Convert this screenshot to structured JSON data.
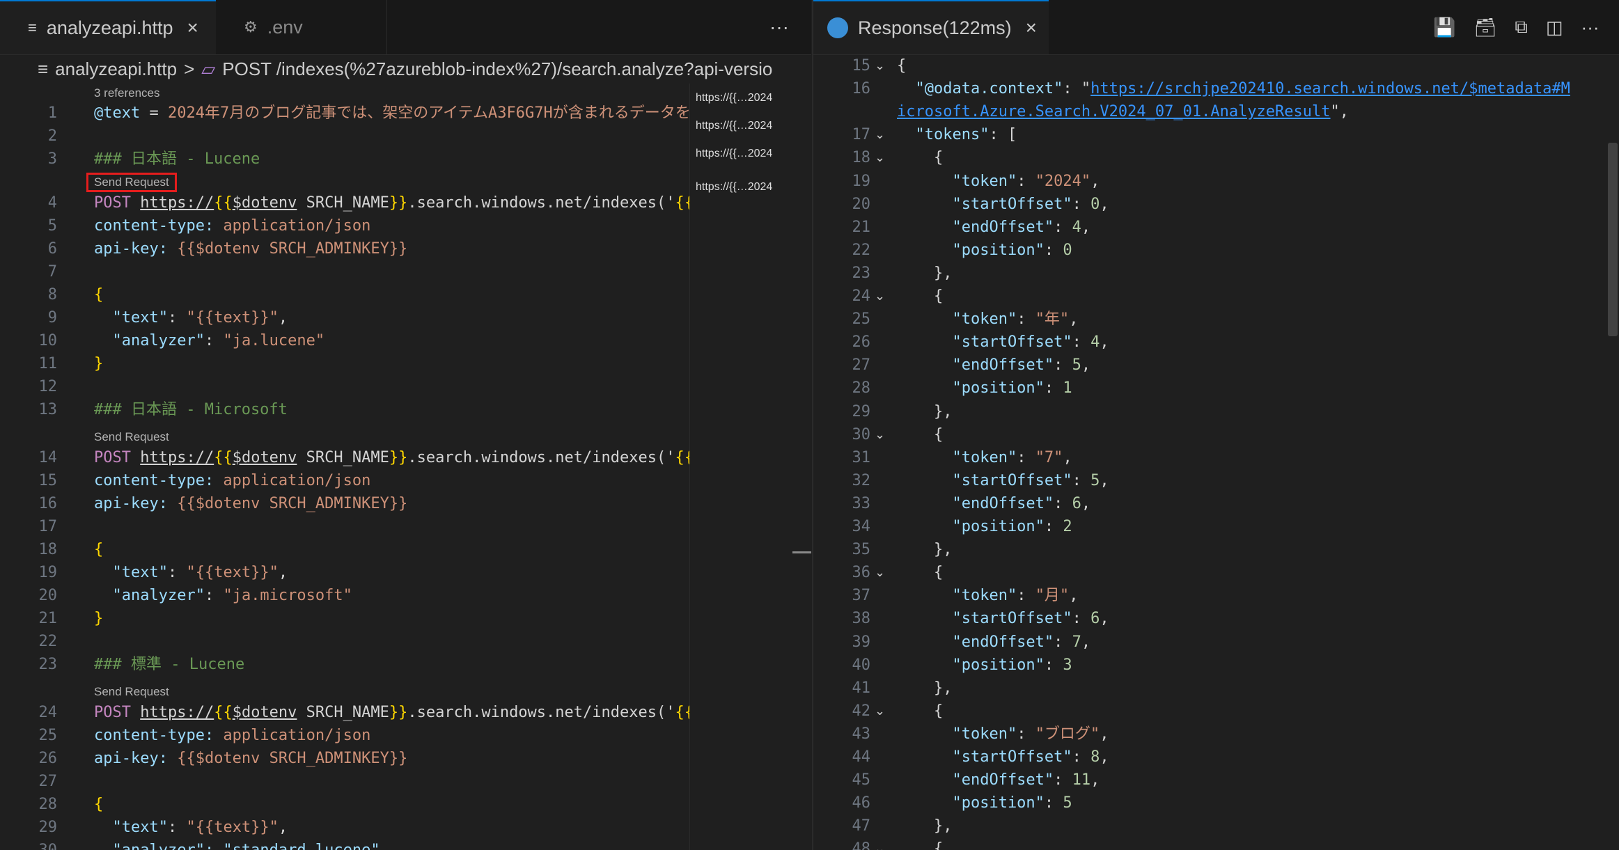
{
  "left": {
    "tabs": [
      {
        "label": "analyzeapi.http",
        "icon": "lines-icon",
        "active": true
      },
      {
        "label": ".env",
        "icon": "gear-icon",
        "active": false
      }
    ],
    "more": "···",
    "breadcrumb": {
      "file": "analyzeapi.http",
      "separator": ">",
      "symbol": "POST /indexes(%27azureblob-index%27)/search.analyze?api-versio"
    },
    "codelens": {
      "references": "3 references",
      "send_request": "Send Request"
    },
    "lines": [
      {
        "n": "1",
        "tokens": [
          [
            "@text",
            "k-meta"
          ],
          [
            " = ",
            "k-plain"
          ],
          [
            "2024年7月のブログ記事では、架空のアイテムA3F6G7Hが含まれるデータを",
            "k-val"
          ]
        ]
      },
      {
        "n": "2",
        "tokens": []
      },
      {
        "n": "3",
        "tokens": [
          [
            "### 日本語 - Lucene",
            "k-com"
          ]
        ]
      },
      {
        "n": "4",
        "tokens": [
          [
            "POST ",
            "k-method"
          ],
          [
            "https://",
            "k-url"
          ],
          [
            "{{",
            "k-brace"
          ],
          [
            "$dotenv",
            "k-url"
          ],
          [
            " SRCH_NAME",
            "k-plain"
          ],
          [
            "}}",
            "k-brace"
          ],
          [
            ".search.windows.net/indexes('",
            "k-plain"
          ],
          [
            "{{",
            "k-brace"
          ]
        ]
      },
      {
        "n": "5",
        "tokens": [
          [
            "content-type:",
            "k-meta"
          ],
          [
            " application/json",
            "k-val"
          ]
        ]
      },
      {
        "n": "6",
        "tokens": [
          [
            "api-key:",
            "k-meta"
          ],
          [
            " {{$dotenv SRCH_ADMINKEY}}",
            "k-val"
          ]
        ]
      },
      {
        "n": "7",
        "tokens": []
      },
      {
        "n": "8",
        "tokens": [
          [
            "{",
            "k-brace"
          ]
        ]
      },
      {
        "n": "9",
        "tokens": [
          [
            "  \"text\"",
            "k-key"
          ],
          [
            ": ",
            "k-plain"
          ],
          [
            "\"{{text}}\"",
            "k-str"
          ],
          [
            ",",
            "k-plain"
          ]
        ]
      },
      {
        "n": "10",
        "tokens": [
          [
            "  \"analyzer\"",
            "k-key"
          ],
          [
            ": ",
            "k-plain"
          ],
          [
            "\"ja.lucene\"",
            "k-str"
          ]
        ]
      },
      {
        "n": "11",
        "tokens": [
          [
            "}",
            "k-brace"
          ]
        ]
      },
      {
        "n": "12",
        "tokens": []
      },
      {
        "n": "13",
        "tokens": [
          [
            "### 日本語 - Microsoft",
            "k-com"
          ]
        ]
      },
      {
        "n": "14",
        "tokens": [
          [
            "POST ",
            "k-method"
          ],
          [
            "https://",
            "k-url"
          ],
          [
            "{{",
            "k-brace"
          ],
          [
            "$dotenv",
            "k-url"
          ],
          [
            " SRCH_NAME",
            "k-plain"
          ],
          [
            "}}",
            "k-brace"
          ],
          [
            ".search.windows.net/indexes('",
            "k-plain"
          ],
          [
            "{{",
            "k-brace"
          ]
        ]
      },
      {
        "n": "15",
        "tokens": [
          [
            "content-type:",
            "k-meta"
          ],
          [
            " application/json",
            "k-val"
          ]
        ]
      },
      {
        "n": "16",
        "tokens": [
          [
            "api-key:",
            "k-meta"
          ],
          [
            " {{$dotenv SRCH_ADMINKEY}}",
            "k-val"
          ]
        ]
      },
      {
        "n": "17",
        "tokens": []
      },
      {
        "n": "18",
        "tokens": [
          [
            "{",
            "k-brace"
          ]
        ]
      },
      {
        "n": "19",
        "tokens": [
          [
            "  \"text\"",
            "k-key"
          ],
          [
            ": ",
            "k-plain"
          ],
          [
            "\"{{text}}\"",
            "k-str"
          ],
          [
            ",",
            "k-plain"
          ]
        ]
      },
      {
        "n": "20",
        "tokens": [
          [
            "  \"analyzer\"",
            "k-key"
          ],
          [
            ": ",
            "k-plain"
          ],
          [
            "\"ja.microsoft\"",
            "k-str"
          ]
        ]
      },
      {
        "n": "21",
        "tokens": [
          [
            "}",
            "k-brace"
          ]
        ]
      },
      {
        "n": "22",
        "tokens": []
      },
      {
        "n": "23",
        "tokens": [
          [
            "### 標準 - Lucene",
            "k-com"
          ]
        ]
      },
      {
        "n": "24",
        "tokens": [
          [
            "POST ",
            "k-method"
          ],
          [
            "https://",
            "k-url"
          ],
          [
            "{{",
            "k-brace"
          ],
          [
            "$dotenv",
            "k-url"
          ],
          [
            " SRCH_NAME",
            "k-plain"
          ],
          [
            "}}",
            "k-brace"
          ],
          [
            ".search.windows.net/indexes('",
            "k-plain"
          ],
          [
            "{{",
            "k-brace"
          ]
        ]
      },
      {
        "n": "25",
        "tokens": [
          [
            "content-type:",
            "k-meta"
          ],
          [
            " application/json",
            "k-val"
          ]
        ]
      },
      {
        "n": "26",
        "tokens": [
          [
            "api-key:",
            "k-meta"
          ],
          [
            " {{$dotenv SRCH_ADMINKEY}}",
            "k-val"
          ]
        ]
      },
      {
        "n": "27",
        "tokens": []
      },
      {
        "n": "28",
        "tokens": [
          [
            "{",
            "k-brace"
          ]
        ]
      },
      {
        "n": "29",
        "tokens": [
          [
            "  \"text\"",
            "k-key"
          ],
          [
            ": ",
            "k-plain"
          ],
          [
            "\"{{text}}\"",
            "k-str"
          ],
          [
            ",",
            "k-plain"
          ]
        ]
      },
      {
        "n": "30",
        "tokens": [
          [
            "  \"analyzer\": \"standard.lucene\"",
            "k-key"
          ]
        ]
      }
    ],
    "minimap_items": [
      "https://{{…2024",
      "https://{{…2024",
      "https://{{…2024",
      "https://{{…2024"
    ]
  },
  "right": {
    "tab": {
      "label": "Response(122ms)",
      "icon": "globe-icon"
    },
    "actions": [
      "save-icon",
      "save-all-icon",
      "copy-icon",
      "split-editor-icon",
      "more-icon"
    ],
    "more": "···",
    "lines": [
      {
        "n": "15",
        "fold": true,
        "tokens": [
          [
            "{",
            "k-plain"
          ]
        ]
      },
      {
        "n": "16",
        "fold": false,
        "tokens": [
          [
            "  \"@odata.context\"",
            "k-key"
          ],
          [
            ": \"",
            "k-plain"
          ],
          [
            "https://srchjpe202410.search.windows.net/$metadata#M",
            "k-link"
          ]
        ]
      },
      {
        "n": "",
        "fold": false,
        "tokens": [
          [
            "icrosoft.Azure.Search.V2024_07_01.AnalyzeResult",
            "k-link"
          ],
          [
            "\",",
            "k-plain"
          ]
        ]
      },
      {
        "n": "17",
        "fold": true,
        "tokens": [
          [
            "  \"tokens\"",
            "k-key"
          ],
          [
            ": [",
            "k-plain"
          ]
        ]
      },
      {
        "n": "18",
        "fold": true,
        "tokens": [
          [
            "    {",
            "k-plain"
          ]
        ]
      },
      {
        "n": "19",
        "fold": false,
        "tokens": [
          [
            "      \"token\"",
            "k-key"
          ],
          [
            ": ",
            "k-plain"
          ],
          [
            "\"2024\"",
            "k-str"
          ],
          [
            ",",
            "k-plain"
          ]
        ]
      },
      {
        "n": "20",
        "fold": false,
        "tokens": [
          [
            "      \"startOffset\"",
            "k-key"
          ],
          [
            ": ",
            "k-plain"
          ],
          [
            "0",
            "k-num"
          ],
          [
            ",",
            "k-plain"
          ]
        ]
      },
      {
        "n": "21",
        "fold": false,
        "tokens": [
          [
            "      \"endOffset\"",
            "k-key"
          ],
          [
            ": ",
            "k-plain"
          ],
          [
            "4",
            "k-num"
          ],
          [
            ",",
            "k-plain"
          ]
        ]
      },
      {
        "n": "22",
        "fold": false,
        "tokens": [
          [
            "      \"position\"",
            "k-key"
          ],
          [
            ": ",
            "k-plain"
          ],
          [
            "0",
            "k-num"
          ]
        ]
      },
      {
        "n": "23",
        "fold": false,
        "tokens": [
          [
            "    },",
            "k-plain"
          ]
        ]
      },
      {
        "n": "24",
        "fold": true,
        "tokens": [
          [
            "    {",
            "k-plain"
          ]
        ]
      },
      {
        "n": "25",
        "fold": false,
        "tokens": [
          [
            "      \"token\"",
            "k-key"
          ],
          [
            ": ",
            "k-plain"
          ],
          [
            "\"年\"",
            "k-str"
          ],
          [
            ",",
            "k-plain"
          ]
        ]
      },
      {
        "n": "26",
        "fold": false,
        "tokens": [
          [
            "      \"startOffset\"",
            "k-key"
          ],
          [
            ": ",
            "k-plain"
          ],
          [
            "4",
            "k-num"
          ],
          [
            ",",
            "k-plain"
          ]
        ]
      },
      {
        "n": "27",
        "fold": false,
        "tokens": [
          [
            "      \"endOffset\"",
            "k-key"
          ],
          [
            ": ",
            "k-plain"
          ],
          [
            "5",
            "k-num"
          ],
          [
            ",",
            "k-plain"
          ]
        ]
      },
      {
        "n": "28",
        "fold": false,
        "tokens": [
          [
            "      \"position\"",
            "k-key"
          ],
          [
            ": ",
            "k-plain"
          ],
          [
            "1",
            "k-num"
          ]
        ]
      },
      {
        "n": "29",
        "fold": false,
        "tokens": [
          [
            "    },",
            "k-plain"
          ]
        ]
      },
      {
        "n": "30",
        "fold": true,
        "tokens": [
          [
            "    {",
            "k-plain"
          ]
        ]
      },
      {
        "n": "31",
        "fold": false,
        "tokens": [
          [
            "      \"token\"",
            "k-key"
          ],
          [
            ": ",
            "k-plain"
          ],
          [
            "\"7\"",
            "k-str"
          ],
          [
            ",",
            "k-plain"
          ]
        ]
      },
      {
        "n": "32",
        "fold": false,
        "tokens": [
          [
            "      \"startOffset\"",
            "k-key"
          ],
          [
            ": ",
            "k-plain"
          ],
          [
            "5",
            "k-num"
          ],
          [
            ",",
            "k-plain"
          ]
        ]
      },
      {
        "n": "33",
        "fold": false,
        "tokens": [
          [
            "      \"endOffset\"",
            "k-key"
          ],
          [
            ": ",
            "k-plain"
          ],
          [
            "6",
            "k-num"
          ],
          [
            ",",
            "k-plain"
          ]
        ]
      },
      {
        "n": "34",
        "fold": false,
        "tokens": [
          [
            "      \"position\"",
            "k-key"
          ],
          [
            ": ",
            "k-plain"
          ],
          [
            "2",
            "k-num"
          ]
        ]
      },
      {
        "n": "35",
        "fold": false,
        "tokens": [
          [
            "    },",
            "k-plain"
          ]
        ]
      },
      {
        "n": "36",
        "fold": true,
        "tokens": [
          [
            "    {",
            "k-plain"
          ]
        ]
      },
      {
        "n": "37",
        "fold": false,
        "tokens": [
          [
            "      \"token\"",
            "k-key"
          ],
          [
            ": ",
            "k-plain"
          ],
          [
            "\"月\"",
            "k-str"
          ],
          [
            ",",
            "k-plain"
          ]
        ]
      },
      {
        "n": "38",
        "fold": false,
        "tokens": [
          [
            "      \"startOffset\"",
            "k-key"
          ],
          [
            ": ",
            "k-plain"
          ],
          [
            "6",
            "k-num"
          ],
          [
            ",",
            "k-plain"
          ]
        ]
      },
      {
        "n": "39",
        "fold": false,
        "tokens": [
          [
            "      \"endOffset\"",
            "k-key"
          ],
          [
            ": ",
            "k-plain"
          ],
          [
            "7",
            "k-num"
          ],
          [
            ",",
            "k-plain"
          ]
        ]
      },
      {
        "n": "40",
        "fold": false,
        "tokens": [
          [
            "      \"position\"",
            "k-key"
          ],
          [
            ": ",
            "k-plain"
          ],
          [
            "3",
            "k-num"
          ]
        ]
      },
      {
        "n": "41",
        "fold": false,
        "tokens": [
          [
            "    },",
            "k-plain"
          ]
        ]
      },
      {
        "n": "42",
        "fold": true,
        "tokens": [
          [
            "    {",
            "k-plain"
          ]
        ]
      },
      {
        "n": "43",
        "fold": false,
        "tokens": [
          [
            "      \"token\"",
            "k-key"
          ],
          [
            ": ",
            "k-plain"
          ],
          [
            "\"ブログ\"",
            "k-str"
          ],
          [
            ",",
            "k-plain"
          ]
        ]
      },
      {
        "n": "44",
        "fold": false,
        "tokens": [
          [
            "      \"startOffset\"",
            "k-key"
          ],
          [
            ": ",
            "k-plain"
          ],
          [
            "8",
            "k-num"
          ],
          [
            ",",
            "k-plain"
          ]
        ]
      },
      {
        "n": "45",
        "fold": false,
        "tokens": [
          [
            "      \"endOffset\"",
            "k-key"
          ],
          [
            ": ",
            "k-plain"
          ],
          [
            "11",
            "k-num"
          ],
          [
            ",",
            "k-plain"
          ]
        ]
      },
      {
        "n": "46",
        "fold": false,
        "tokens": [
          [
            "      \"position\"",
            "k-key"
          ],
          [
            ": ",
            "k-plain"
          ],
          [
            "5",
            "k-num"
          ]
        ]
      },
      {
        "n": "47",
        "fold": false,
        "tokens": [
          [
            "    },",
            "k-plain"
          ]
        ]
      },
      {
        "n": "48",
        "fold": true,
        "tokens": [
          [
            "    {",
            "k-plain"
          ]
        ]
      }
    ]
  },
  "colors": {
    "accent": "#0078d4",
    "highlight_box": "#e51d1d",
    "background": "#1f1f1f"
  }
}
